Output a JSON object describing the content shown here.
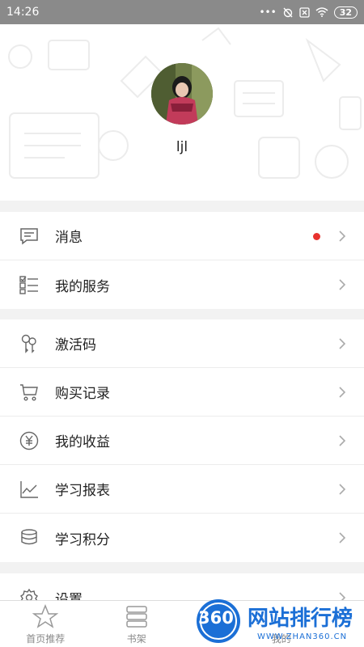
{
  "status_bar": {
    "time": "14:26",
    "battery": "32"
  },
  "profile": {
    "username": "ljl"
  },
  "menu_group_1": [
    {
      "label": "消息",
      "has_badge": true
    },
    {
      "label": "我的服务"
    }
  ],
  "menu_group_2": [
    {
      "label": "激活码"
    },
    {
      "label": "购买记录"
    },
    {
      "label": "我的收益"
    },
    {
      "label": "学习报表"
    },
    {
      "label": "学习积分"
    }
  ],
  "menu_group_3": [
    {
      "label": "设置"
    }
  ],
  "tab_bar": [
    {
      "label": "首页推荐"
    },
    {
      "label": "书架"
    },
    {
      "label": ""
    },
    {
      "label": "我的"
    }
  ],
  "watermark": {
    "badge": "360",
    "title": "网站排行榜",
    "url": "WWW.ZHAN360.CN"
  },
  "colors": {
    "badge": "#e8322e",
    "watermark_blue": "#1b6fd6",
    "status_bar": "#8a8a8a"
  }
}
